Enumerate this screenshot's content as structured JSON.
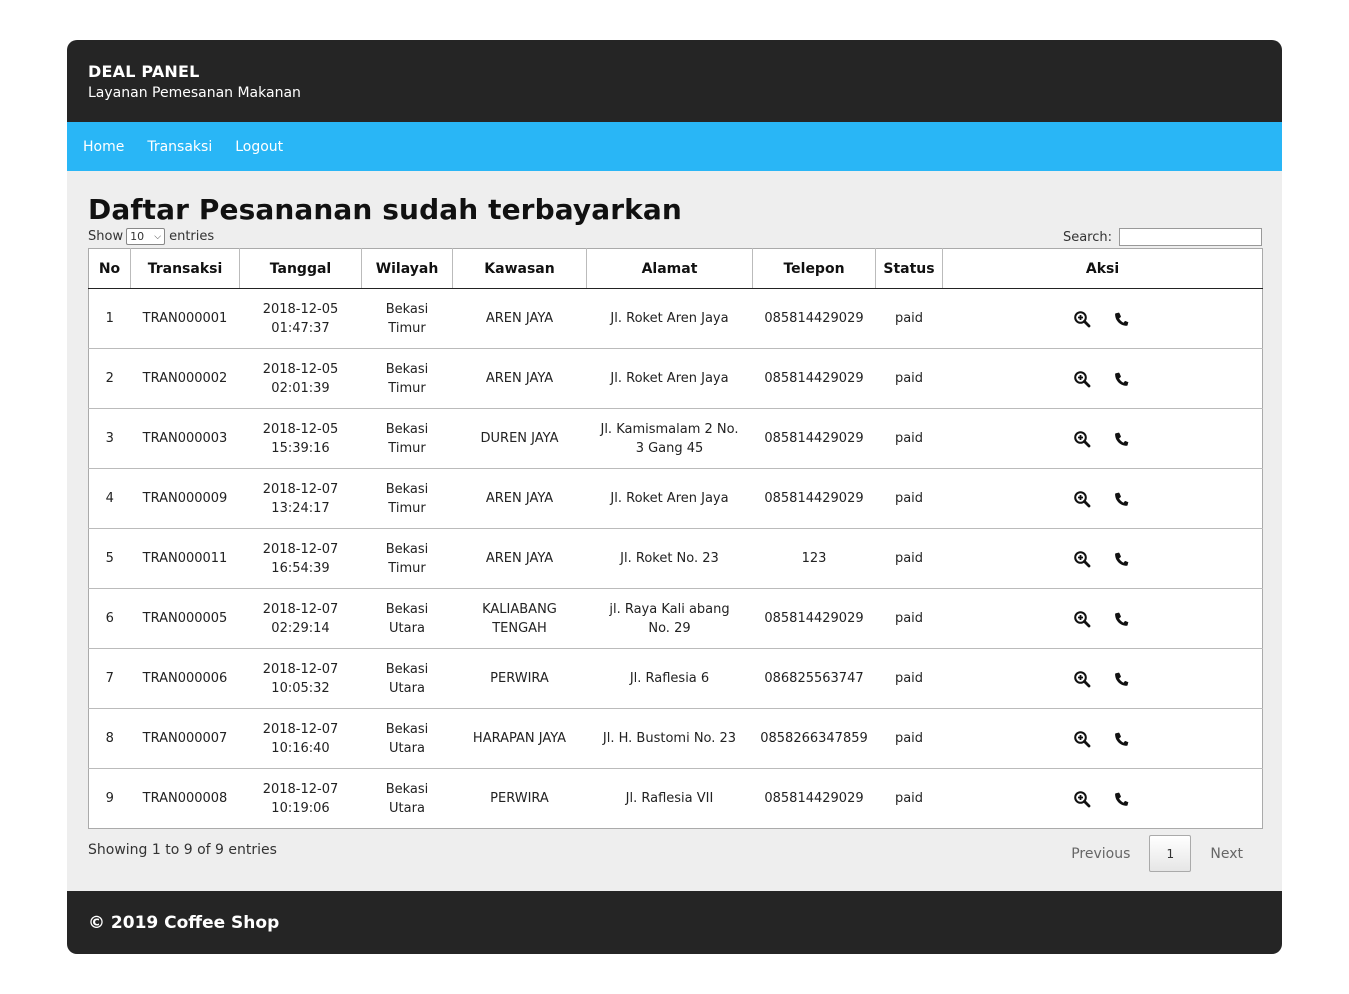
{
  "header": {
    "brand": "DEAL PANEL",
    "tagline": "Layanan Pemesanan Makanan"
  },
  "nav": [
    {
      "label": "Home"
    },
    {
      "label": "Transaksi"
    },
    {
      "label": "Logout"
    }
  ],
  "page_title": "Daftar Pesananan sudah terbayarkan",
  "controls": {
    "show_label": "Show",
    "length_value": "10",
    "entries_label": "entries",
    "search_label": "Search:"
  },
  "table": {
    "columns": [
      "No",
      "Transaksi",
      "Tanggal",
      "Wilayah",
      "Kawasan",
      "Alamat",
      "Telepon",
      "Status",
      "Aksi"
    ],
    "rows": [
      {
        "no": "1",
        "transaksi": "TRAN000001",
        "tanggal_date": "2018-12-05",
        "tanggal_time": "01:47:37",
        "wilayah_a": "Bekasi",
        "wilayah_b": "Timur",
        "kawasan_a": "AREN JAYA",
        "kawasan_b": "",
        "alamat_a": "Jl. Roket Aren Jaya",
        "alamat_b": "",
        "telepon": "085814429029",
        "status": "paid"
      },
      {
        "no": "2",
        "transaksi": "TRAN000002",
        "tanggal_date": "2018-12-05",
        "tanggal_time": "02:01:39",
        "wilayah_a": "Bekasi",
        "wilayah_b": "Timur",
        "kawasan_a": "AREN JAYA",
        "kawasan_b": "",
        "alamat_a": "Jl. Roket Aren Jaya",
        "alamat_b": "",
        "telepon": "085814429029",
        "status": "paid"
      },
      {
        "no": "3",
        "transaksi": "TRAN000003",
        "tanggal_date": "2018-12-05",
        "tanggal_time": "15:39:16",
        "wilayah_a": "Bekasi",
        "wilayah_b": "Timur",
        "kawasan_a": "DUREN JAYA",
        "kawasan_b": "",
        "alamat_a": "Jl. Kamismalam 2 No.",
        "alamat_b": "3 Gang 45",
        "telepon": "085814429029",
        "status": "paid"
      },
      {
        "no": "4",
        "transaksi": "TRAN000009",
        "tanggal_date": "2018-12-07",
        "tanggal_time": "13:24:17",
        "wilayah_a": "Bekasi",
        "wilayah_b": "Timur",
        "kawasan_a": "AREN JAYA",
        "kawasan_b": "",
        "alamat_a": "Jl. Roket Aren Jaya",
        "alamat_b": "",
        "telepon": "085814429029",
        "status": "paid"
      },
      {
        "no": "5",
        "transaksi": "TRAN000011",
        "tanggal_date": "2018-12-07",
        "tanggal_time": "16:54:39",
        "wilayah_a": "Bekasi",
        "wilayah_b": "Timur",
        "kawasan_a": "AREN JAYA",
        "kawasan_b": "",
        "alamat_a": "Jl. Roket No. 23",
        "alamat_b": "",
        "telepon": "123",
        "status": "paid"
      },
      {
        "no": "6",
        "transaksi": "TRAN000005",
        "tanggal_date": "2018-12-07",
        "tanggal_time": "02:29:14",
        "wilayah_a": "Bekasi",
        "wilayah_b": "Utara",
        "kawasan_a": "KALIABANG",
        "kawasan_b": "TENGAH",
        "alamat_a": "jl. Raya Kali abang",
        "alamat_b": "No. 29",
        "telepon": "085814429029",
        "status": "paid"
      },
      {
        "no": "7",
        "transaksi": "TRAN000006",
        "tanggal_date": "2018-12-07",
        "tanggal_time": "10:05:32",
        "wilayah_a": "Bekasi",
        "wilayah_b": "Utara",
        "kawasan_a": "PERWIRA",
        "kawasan_b": "",
        "alamat_a": "Jl. Raflesia 6",
        "alamat_b": "",
        "telepon": "086825563747",
        "status": "paid"
      },
      {
        "no": "8",
        "transaksi": "TRAN000007",
        "tanggal_date": "2018-12-07",
        "tanggal_time": "10:16:40",
        "wilayah_a": "Bekasi",
        "wilayah_b": "Utara",
        "kawasan_a": "HARAPAN JAYA",
        "kawasan_b": "",
        "alamat_a": "Jl. H. Bustomi No. 23",
        "alamat_b": "",
        "telepon": "0858266347859",
        "status": "paid"
      },
      {
        "no": "9",
        "transaksi": "TRAN000008",
        "tanggal_date": "2018-12-07",
        "tanggal_time": "10:19:06",
        "wilayah_a": "Bekasi",
        "wilayah_b": "Utara",
        "kawasan_a": "PERWIRA",
        "kawasan_b": "",
        "alamat_a": "Jl. Raflesia VII",
        "alamat_b": "",
        "telepon": "085814429029",
        "status": "paid"
      }
    ],
    "action_icons": [
      "zoom-in-icon",
      "phone-icon"
    ]
  },
  "info_text": "Showing 1 to 9 of 9 entries",
  "pagination": {
    "previous": "Previous",
    "current_page": "1",
    "next": "Next"
  },
  "footer": {
    "text": "© 2019 Coffee Shop"
  },
  "colors": {
    "header_bg": "#252525",
    "nav_bg": "#29b6f6",
    "content_bg": "#eeeeee"
  }
}
